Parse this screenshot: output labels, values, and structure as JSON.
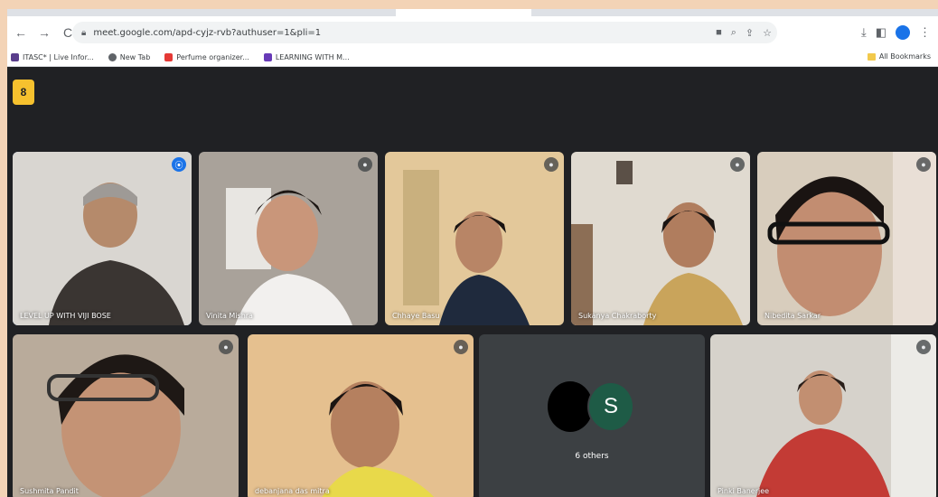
{
  "browser": {
    "url": "meet.google.com/apd-cyjz-rvb?authuser=1&pli=1",
    "nav": {
      "back": "←",
      "forward": "→",
      "reload": "C"
    },
    "bookmarks": [
      {
        "label": "ITASC* | Live Infor...",
        "color": "#5a3e8c"
      },
      {
        "label": "New Tab",
        "color": "#5f6368"
      },
      {
        "label": "Perfume organizer...",
        "color": "#e53935"
      },
      {
        "label": "LEARNING WITH M...",
        "color": "#673ab7"
      }
    ],
    "all_bookmarks": "All Bookmarks"
  },
  "meet": {
    "badge": "8",
    "tiles": [
      {
        "name": "LEVEL UP WITH VIJI BOSE",
        "speaking": true,
        "bg": "#c7c4bf"
      },
      {
        "name": "Vinita Mishra",
        "speaking": false,
        "bg": "#a9a29a"
      },
      {
        "name": "Chhaye Basu",
        "speaking": false,
        "bg": "#e3c89a"
      },
      {
        "name": "Sukanya Chakraborty",
        "speaking": false,
        "bg": "#cfc7b7"
      },
      {
        "name": "Nibedita Sarkar",
        "speaking": false,
        "bg": "#d8cdbd"
      },
      {
        "name": "Sushmita Pandit",
        "speaking": false,
        "bg": "#b9ab9b"
      },
      {
        "name": "debanjana das mitra",
        "speaking": false,
        "bg": "#e5c08f"
      },
      {
        "name": "Pinki Banerjee",
        "speaking": false,
        "bg": "#d6d2cb"
      }
    ],
    "others": {
      "count_label": "6 others",
      "avatar_letter": "S"
    }
  },
  "colors": {
    "meet_bg": "#202124",
    "speaking_outline": "#8ab4f8",
    "page_bg": "#f3d3b6"
  }
}
